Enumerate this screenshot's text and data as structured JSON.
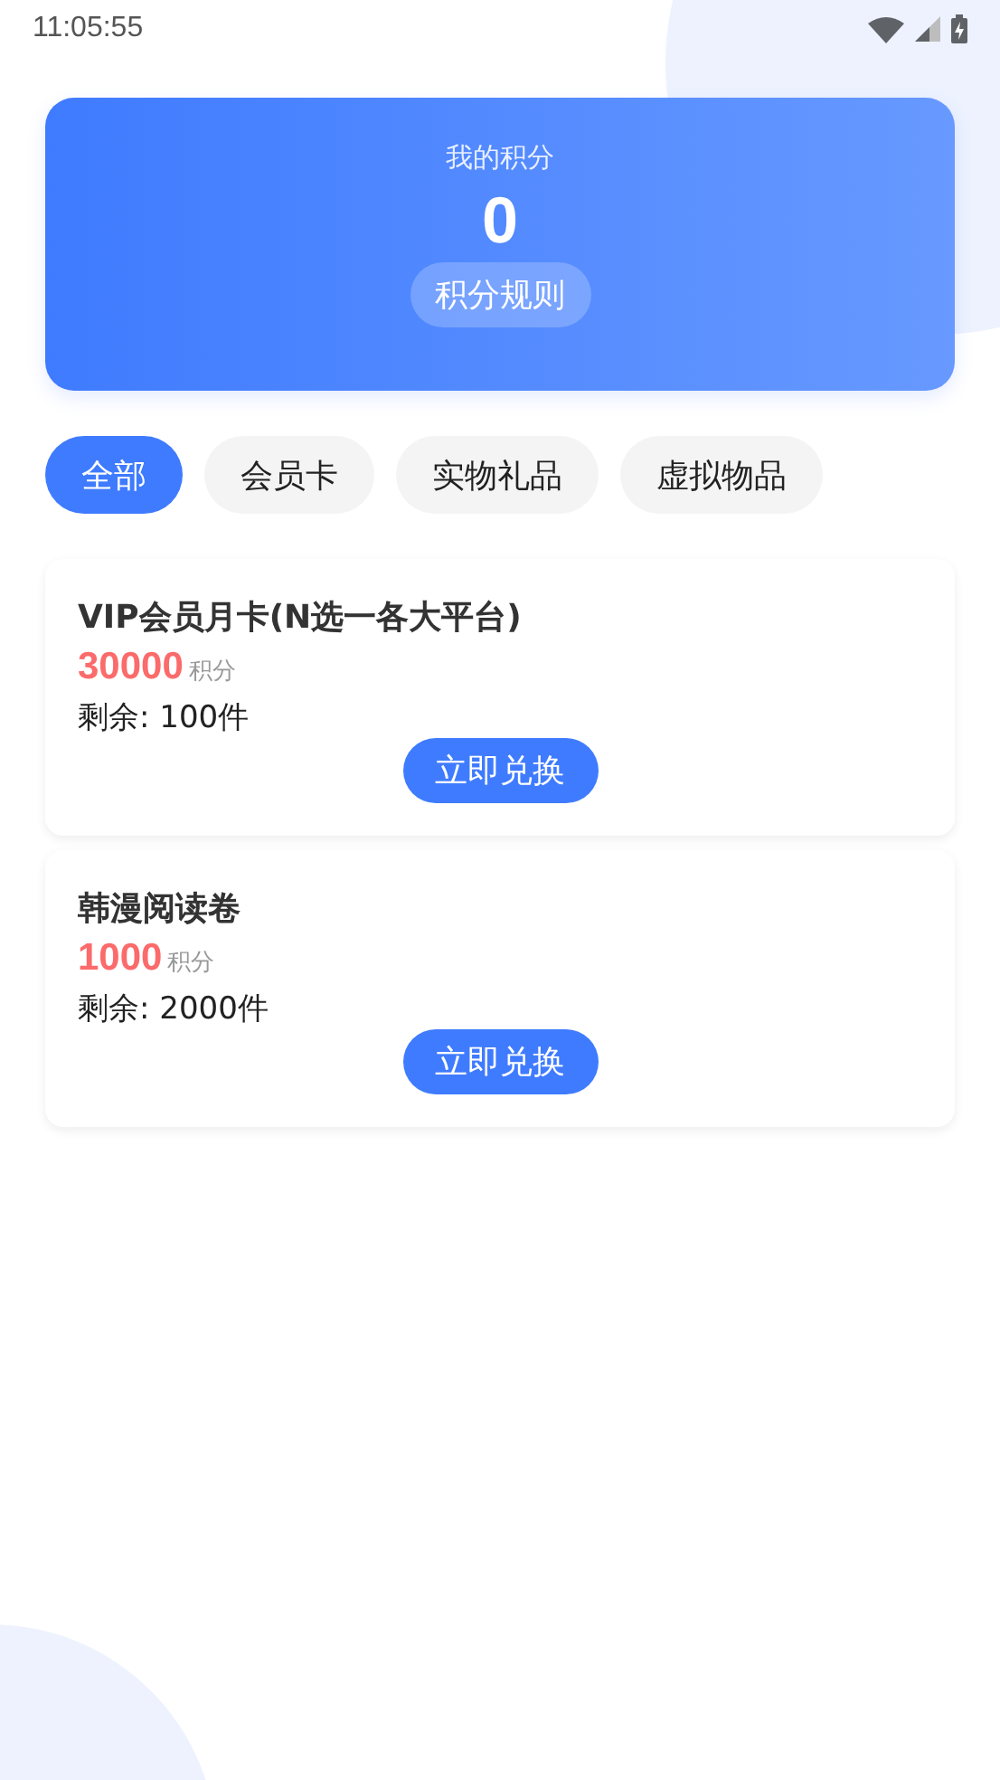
{
  "status_bar": {
    "time": "11:05:55"
  },
  "points_card": {
    "label": "我的积分",
    "value": "0",
    "rules_button": "积分规则"
  },
  "tabs": [
    {
      "label": "全部",
      "selected": true
    },
    {
      "label": "会员卡",
      "selected": false
    },
    {
      "label": "实物礼品",
      "selected": false
    },
    {
      "label": "虚拟物品",
      "selected": false
    }
  ],
  "items": [
    {
      "title": "VIP会员月卡(N选一各大平台)",
      "price": "30000",
      "unit": "积分",
      "stock": "剩余: 100件",
      "button": "立即兑换"
    },
    {
      "title": "韩漫阅读卷",
      "price": "1000",
      "unit": "积分",
      "stock": "剩余: 2000件",
      "button": "立即兑换"
    }
  ]
}
